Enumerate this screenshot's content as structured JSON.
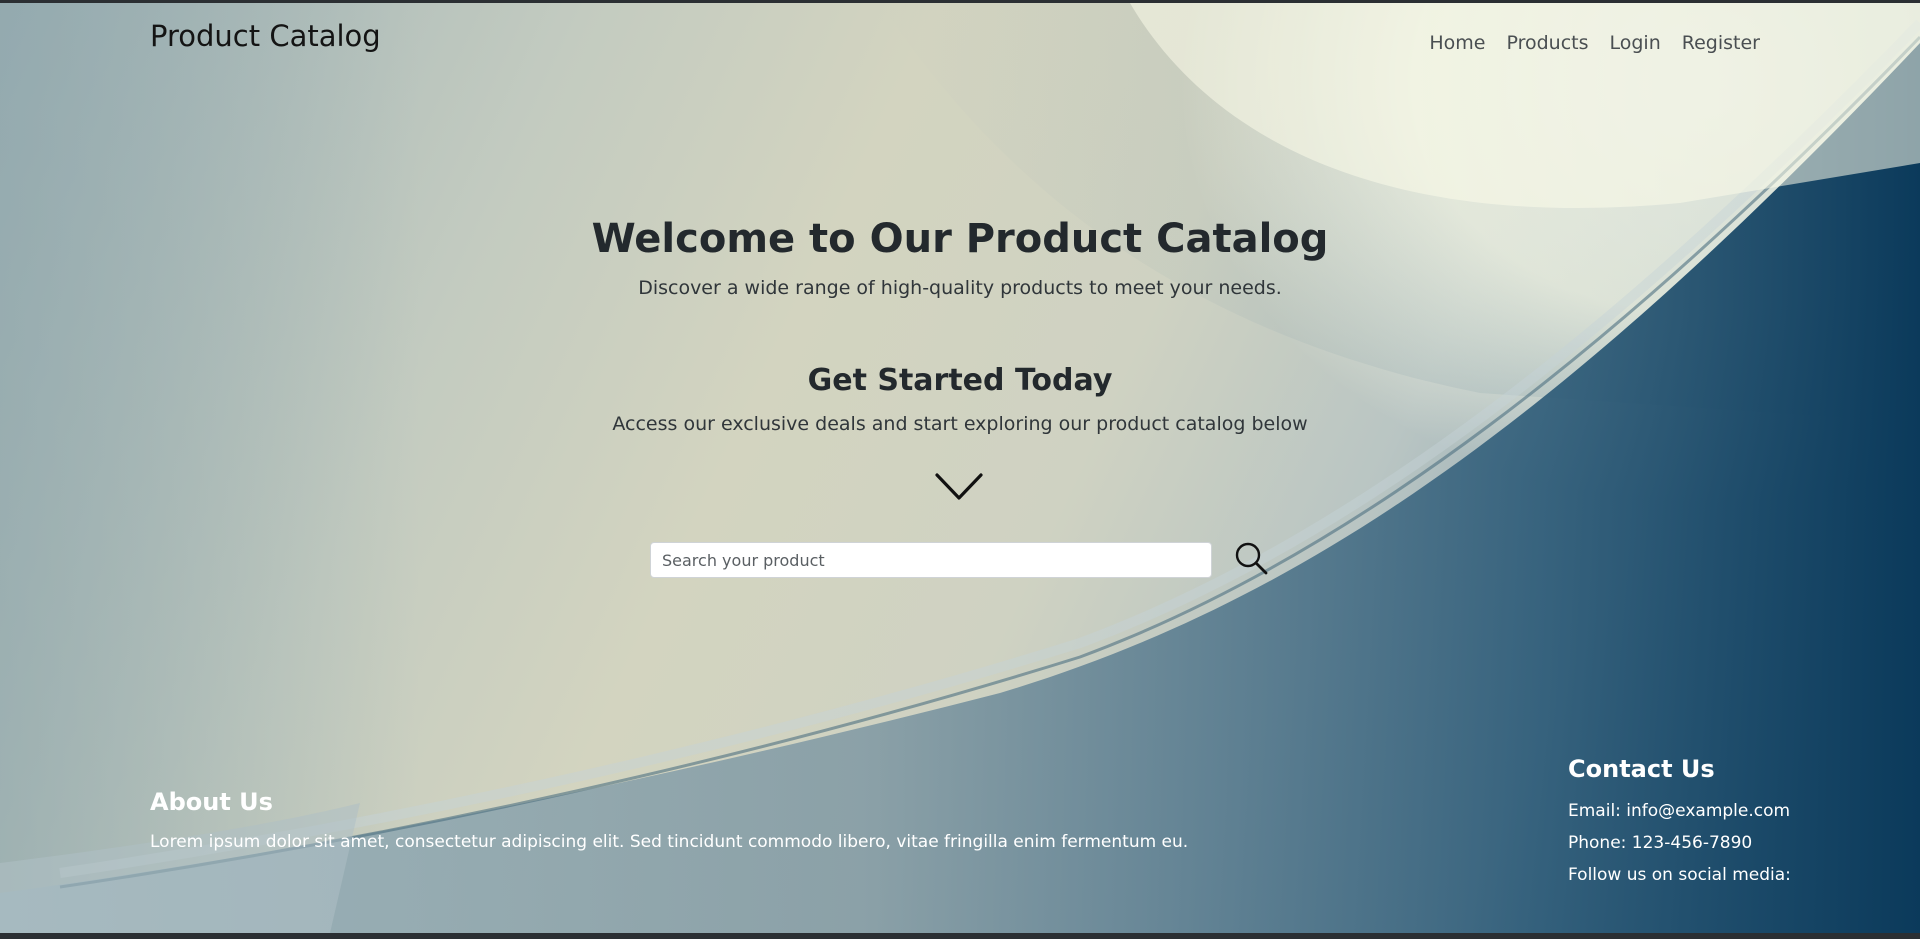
{
  "header": {
    "brand": "Product Catalog",
    "nav": [
      "Home",
      "Products",
      "Login",
      "Register"
    ]
  },
  "hero": {
    "title": "Welcome to Our Product Catalog",
    "subtitle": "Discover a wide range of high-quality products to meet your needs."
  },
  "cta": {
    "title": "Get Started Today",
    "subtitle": "Access our exclusive deals and start exploring our product catalog below"
  },
  "search": {
    "placeholder": "Search your product",
    "value": "",
    "icon": "search-icon"
  },
  "footer": {
    "about": {
      "title": "About Us",
      "text": "Lorem ipsum dolor sit amet, consectetur adipiscing elit. Sed tincidunt commodo libero, vitae fringilla enim fermentum eu."
    },
    "contact": {
      "title": "Contact Us",
      "email": "Email: info@example.com",
      "phone": "Phone: 123-456-7890",
      "social": "Follow us on social media:"
    }
  },
  "colors": {
    "text_dark": "#23292d",
    "nav_text": "#4a4f52",
    "footer_text": "#ffffff",
    "deep_blue": "#0f3d5e"
  }
}
